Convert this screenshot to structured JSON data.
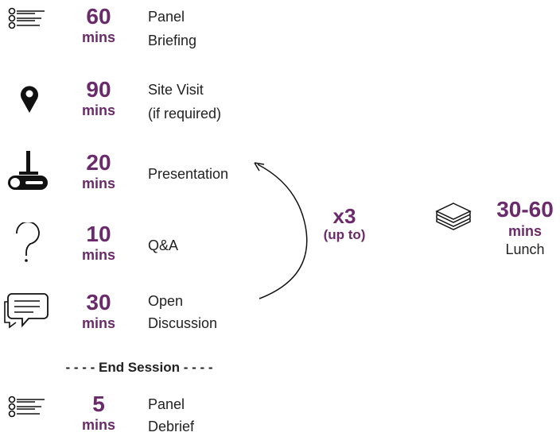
{
  "rows": [
    {
      "num": "60",
      "unit": "mins",
      "label1": "Panel",
      "label2": "Briefing",
      "icon": "checklist-icon"
    },
    {
      "num": "90",
      "unit": "mins",
      "label1": "Site Visit",
      "label2": "(if required)",
      "icon": "location-pin-icon"
    },
    {
      "num": "20",
      "unit": "mins",
      "label1": "Presentation",
      "label2": "",
      "icon": "projector-icon"
    },
    {
      "num": "10",
      "unit": "mins",
      "label1": "Q&A",
      "label2": "",
      "icon": "question-mark-icon"
    },
    {
      "num": "30",
      "unit": "mins",
      "label1": "Open",
      "label2": "Discussion",
      "icon": "speech-bubble-icon"
    },
    {
      "num": "5",
      "unit": "mins",
      "label1": "Panel",
      "label2": "Debrief",
      "icon": "checklist-icon"
    }
  ],
  "end_session": "- - - - End Session - - - -",
  "repeat": {
    "big": "x3",
    "small": "(up to)"
  },
  "lunch": {
    "num": "30-60",
    "unit": "mins",
    "label": "Lunch",
    "icon": "sandwich-icon"
  },
  "accent_color": "#6a2a6b"
}
